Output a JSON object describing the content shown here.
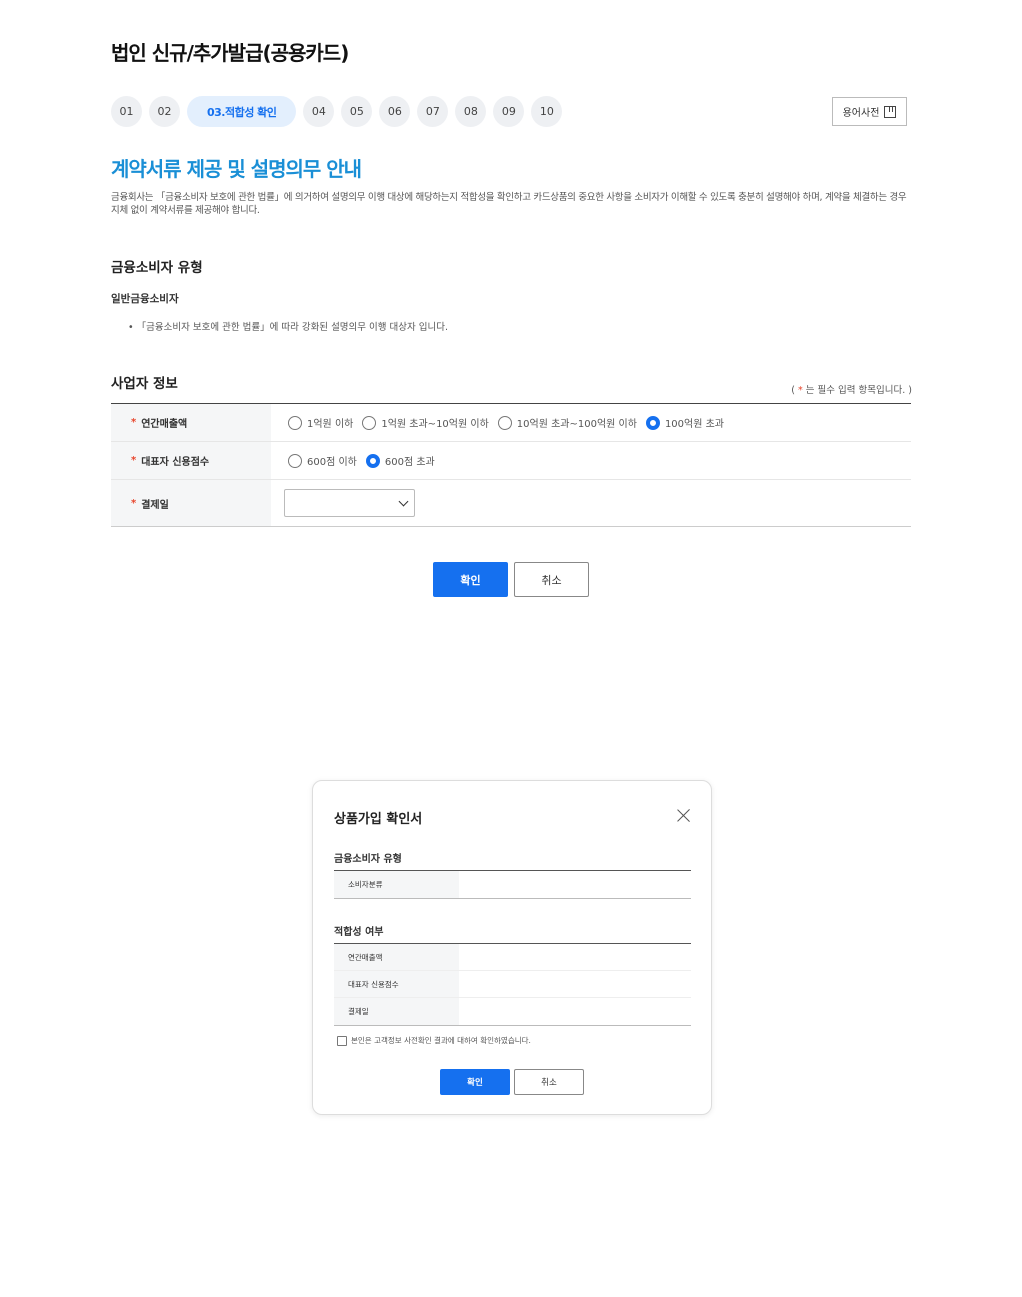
{
  "page_title": "법인 신규/추가발급(공용카드)",
  "steps": [
    "01",
    "02",
    "03.적합성 확인",
    "04",
    "05",
    "06",
    "07",
    "08",
    "09",
    "10"
  ],
  "glossary_label": "용어사전",
  "section_title": "계약서류 제공 및 설명의무 안내",
  "description": "금융회사는 「금융소비자 보호에 관한 법률」에 의거하여 설명의무 이행 대상에 해당하는지 적합성을 확인하고 카드상품의 중요한 사항을 소비자가 이해할 수 있도록 충분히 설명해야 하며, 계약을 체결하는 경우 지체 없이 계약서류를 제공해야 합니다.",
  "consumer_type": {
    "heading": "금융소비자 유형",
    "value": "일반금융소비자",
    "note": "「금융소비자 보호에 관한 법률」에 따라 강화된 설명의무 이행 대상자 입니다."
  },
  "business_info": {
    "heading": "사업자 정보",
    "required_note_prefix": "( ",
    "required_mark": "*",
    "required_note_suffix": " 는 필수 입력 항목입니다. )",
    "rows": {
      "annual_sales": {
        "label": "연간매출액",
        "options": [
          "1억원 이하",
          "1억원 초과~10억원 이하",
          "10억원 초과~100억원 이하",
          "100억원 초과"
        ],
        "selected": "100억원 초과"
      },
      "credit_score": {
        "label": "대표자 신용점수",
        "options": [
          "600점 이하",
          "600점 초과"
        ],
        "selected": "600점 초과"
      },
      "payment_day": {
        "label": "결제일",
        "value": ""
      }
    }
  },
  "buttons": {
    "confirm": "확인",
    "cancel": "취소"
  },
  "modal": {
    "title": "상품가입 확인서",
    "section1_heading": "금융소비자 유형",
    "section1_rows": [
      {
        "label": "소비자분류",
        "value": ""
      }
    ],
    "section2_heading": "적합성 여부",
    "section2_rows": [
      {
        "label": "연간매출액",
        "value": ""
      },
      {
        "label": "대표자 신용점수",
        "value": ""
      },
      {
        "label": "결제일",
        "value": ""
      }
    ],
    "checkbox_label": "본인은 고객정보 사전확인 결과에 대하여 확인하였습니다.",
    "confirm": "확인",
    "cancel": "취소"
  },
  "colors": {
    "accent": "#1570ef",
    "title_blue": "#1a8fd6",
    "required": "#e8452c"
  },
  "icons": {
    "glossary": "book-icon",
    "modal_close": "close-icon",
    "select": "chevron-down-icon"
  }
}
